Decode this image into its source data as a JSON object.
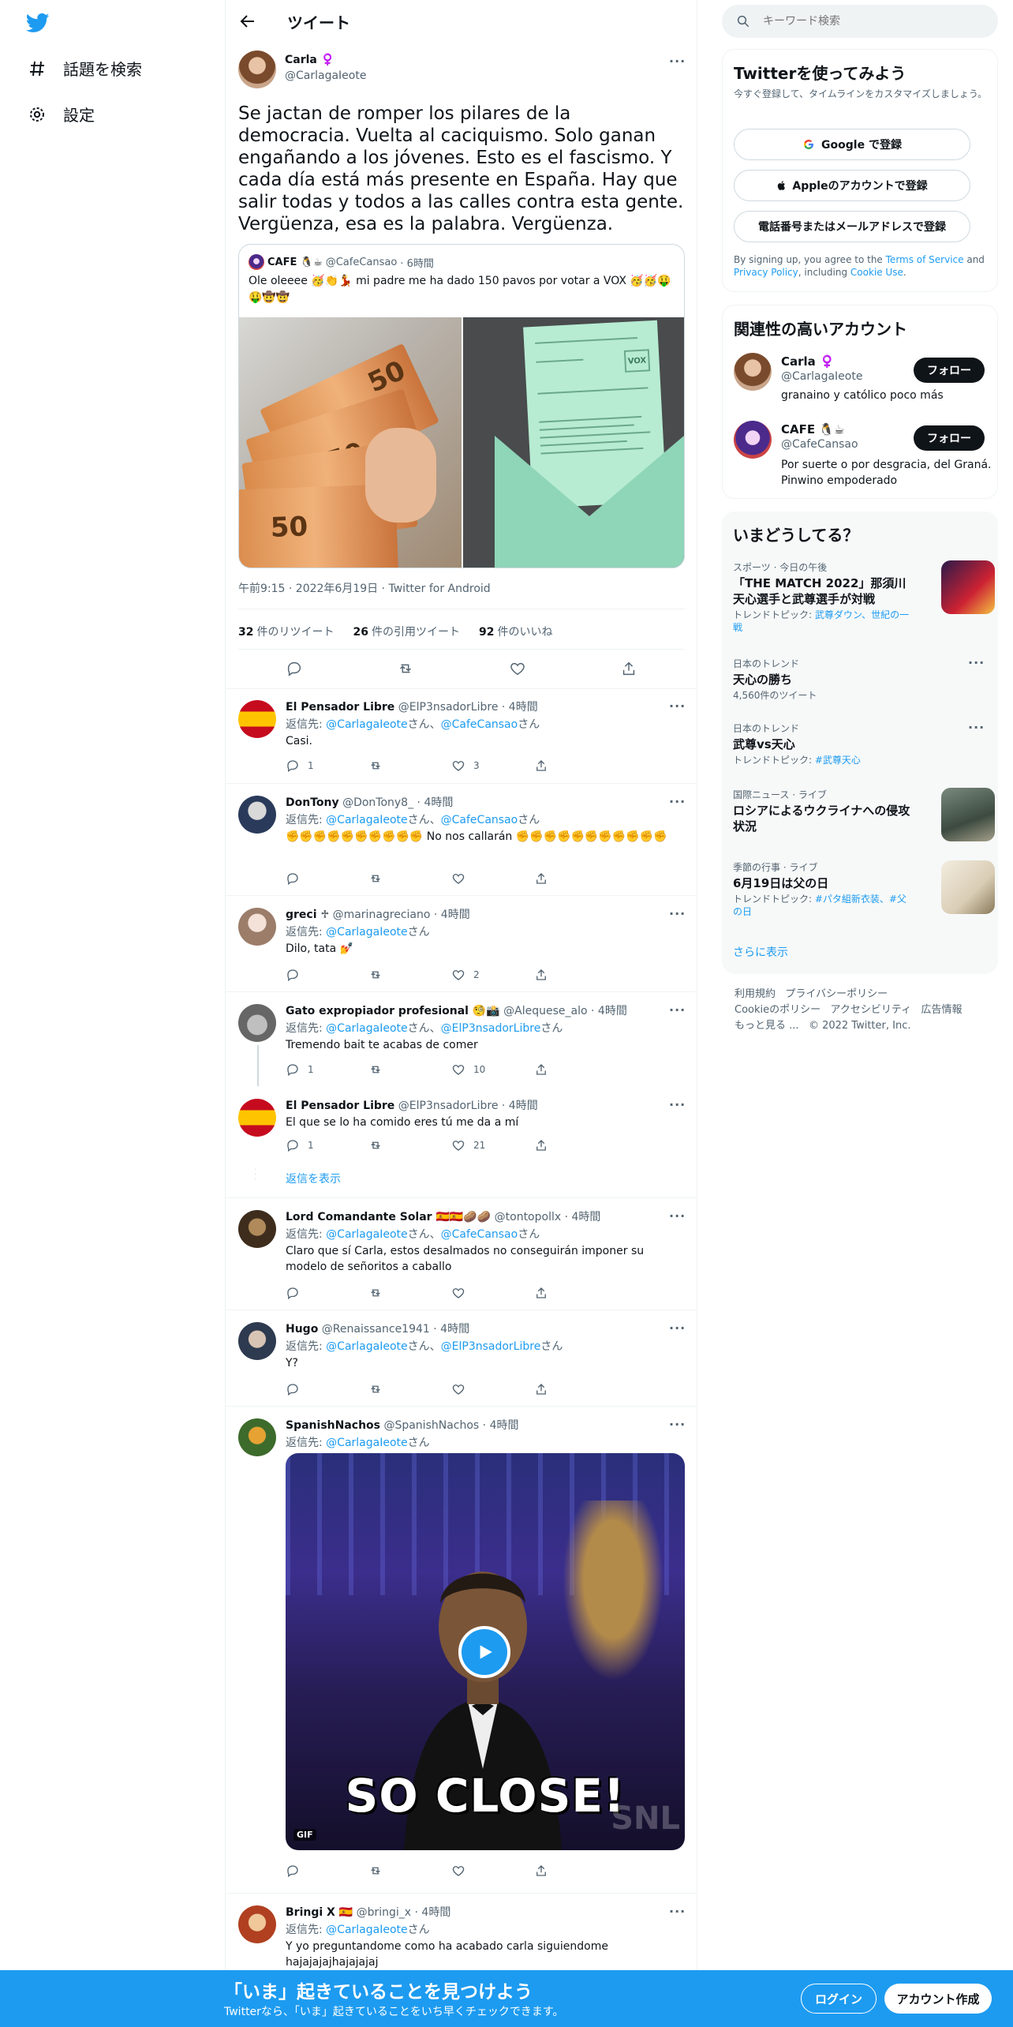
{
  "nav": {
    "explore": "話題を検索",
    "settings": "設定"
  },
  "header": {
    "title": "ツイート"
  },
  "tweet": {
    "name": "Carla ♀️",
    "handle": "@CarlagaIeote",
    "text": "Se jactan de romper los pilares de la democracia. Vuelta al caciquismo. Solo ganan engañando a los jóvenes. Esto es el fascismo. Y cada día está más presente en España. Hay que salir todas y todos a las calles contra esta gente. Vergüenza, esa es la palabra. Vergüenza.",
    "quote": {
      "name": "CAFE 🐧☕",
      "handle": "@CafeCansao",
      "time": "· 6時間",
      "text": "Ole oleeee 🥳👏💃 mi padre me ha dado 150 pavos por votar a VOX 🥳🥳🤑🤑🤠🤠"
    },
    "meta": "午前9:15 · 2022年6月19日 · Twitter for Android",
    "stats": {
      "retweets": "32",
      "retweets_label": "件のリツイート",
      "quotes": "26",
      "quotes_label": "件の引用ツイート",
      "likes": "92",
      "likes_label": "件のいいね"
    }
  },
  "replies": [
    {
      "name": "El Pensador Libre",
      "handle": "@ElP3nsadorLibre",
      "time": "· 4時間",
      "to_prefix": "返信先: ",
      "to1": "@CarlagaIeote",
      "to_mid": "さん、",
      "to2": "@CafeCansao",
      "to_suffix": "さん",
      "text": "Casi.",
      "replies": "1",
      "retweets": "",
      "likes": "3"
    },
    {
      "name": "DonTony",
      "handle": "@DonTony8_",
      "time": "· 4時間",
      "to_prefix": "返信先: ",
      "to1": "@CarlagaIeote",
      "to_mid": "さん、",
      "to2": "@CafeCansao",
      "to_suffix": "さん",
      "text": "✊✊✊✊✊✊✊✊✊✊ No nos callarán ✊✊✊✊✊✊✊✊✊✊✊",
      "replies": "",
      "retweets": "",
      "likes": ""
    },
    {
      "name": "greci ♱",
      "handle": "@marinagreciano",
      "time": "· 4時間",
      "to_prefix": "返信先: ",
      "to1": "@CarlagaIeote",
      "to_suffix": "さん",
      "text": "Dilo, tata 💅",
      "replies": "",
      "retweets": "",
      "likes": "2"
    },
    {
      "name": "Gato expropiador profesional 🧐📸",
      "handle": "@Alequese_alo",
      "time": "· 4時間",
      "to_prefix": "返信先: ",
      "to1": "@CarlagaIeote",
      "to_mid": "さん、",
      "to2": "@ElP3nsadorLibre",
      "to_suffix": "さん",
      "text": "Tremendo bait te acabas de comer",
      "replies": "1",
      "retweets": "",
      "likes": "10"
    },
    {
      "name": "El Pensador Libre",
      "handle": "@ElP3nsadorLibre",
      "time": "· 4時間",
      "text": "El que se lo ha comido eres tú me da a mí",
      "replies": "1",
      "retweets": "",
      "likes": "21"
    },
    {
      "name": "Lord Comandante Solar 🇪🇸🇪🇸🥔🥔",
      "handle": "@tontopollx",
      "time": "· 4時間",
      "to_prefix": "返信先: ",
      "to1": "@CarlagaIeote",
      "to_mid": "さん、",
      "to2": "@CafeCansao",
      "to_suffix": "さん",
      "text": "Claro que sí Carla, estos desalmados no conseguirán imponer su modelo de señoritos a caballo",
      "replies": "",
      "retweets": "",
      "likes": ""
    },
    {
      "name": "Hugo",
      "handle": "@Renaissance1941",
      "time": "· 4時間",
      "to_prefix": "返信先: ",
      "to1": "@CarlagaIeote",
      "to_mid": "さん、",
      "to2": "@ElP3nsadorLibre",
      "to_suffix": "さん",
      "text": "Y?",
      "replies": "",
      "retweets": "",
      "likes": ""
    },
    {
      "name": "SpanishNachos",
      "handle": "@SpanishNachos",
      "time": "· 4時間",
      "to_prefix": "返信先: ",
      "to1": "@CarlagaIeote",
      "to_suffix": "さん",
      "gif_caption": "SO CLOSE!",
      "gif_tag": "GIF",
      "gif_watermark": "SNL",
      "replies": "",
      "retweets": "",
      "likes": ""
    },
    {
      "name": "Bringi X 🇪🇸",
      "handle": "@bringi_x",
      "time": "· 4時間",
      "to_prefix": "返信先: ",
      "to1": "@CarlagaIeote",
      "to_suffix": "さん",
      "text": "Y yo preguntandome como ha acabado carla siguiendome hajajajajhajajajaj"
    }
  ],
  "show_replies": "返信を表示",
  "sidebar": {
    "search_placeholder": "キーワード検索",
    "signup": {
      "title": "Twitterを使ってみよう",
      "sub": "今すぐ登録して、タイムラインをカスタマイズしましょう。",
      "google": "Google で登録",
      "apple": "Appleのアカウントで登録",
      "phone": "電話番号またはメールアドレスで登録",
      "terms_pre": "By signing up, you agree to the ",
      "terms": "Terms of Service",
      "terms_mid": " and ",
      "privacy": "Privacy Policy",
      "terms_mid2": ", including ",
      "cookie": "Cookie Use",
      "terms_end": "."
    },
    "related": {
      "title": "関連性の高いアカウント",
      "accounts": [
        {
          "name": "Carla ♀️",
          "handle": "@CarlagaIeote",
          "bio": "granaino y católico poco más",
          "button": "フォロー"
        },
        {
          "name": "CAFE 🐧☕",
          "handle": "@CafeCansao",
          "bio": "Por suerte o por desgracia, del Graná. Pinwino empoderado",
          "button": "フォロー"
        }
      ]
    },
    "trends": {
      "title": "いまどうしてる？",
      "items": [
        {
          "cat": "スポーツ · 今日の午後",
          "title": "「THE MATCH 2022」那須川天心選手と武尊選手が対戦",
          "sub_pre": "トレンドトピック: ",
          "sub_link": "武尊ダウン、世紀の一戦",
          "sub_count": ""
        },
        {
          "cat": "日本のトレンド",
          "title": "天心の勝ち",
          "sub_pre": "",
          "sub_link": "",
          "sub_count": "4,560件のツイート"
        },
        {
          "cat": "日本のトレンド",
          "title": "武尊vs天心",
          "sub_pre": "トレンドトピック: ",
          "sub_link": "#武尊天心",
          "sub_count": ""
        },
        {
          "cat": "国際ニュース · ライブ",
          "title": "ロシアによるウクライナへの侵攻状況",
          "sub_pre": "",
          "sub_link": "",
          "sub_count": ""
        },
        {
          "cat": "季節の行事 · ライブ",
          "title": "6月19日は父の日",
          "sub_pre": "トレンドトピック: ",
          "sub_link": "#パタ組新衣装、#父の日",
          "sub_count": ""
        }
      ],
      "more": "さらに表示"
    },
    "footer": {
      "l1": "利用規約",
      "l2": "プライバシーポリシー",
      "l3": "Cookieのポリシー",
      "l4": "アクセシビリティ",
      "l5": "広告情報",
      "l6": "もっと見る ...",
      "copy": "© 2022 Twitter, Inc."
    }
  },
  "bottom": {
    "title": "「いま」起きていることを見つけよう",
    "sub": "Twitterなら、「いま」起きていることをいち早くチェックできます。",
    "login": "ログイン",
    "signup": "アカウント作成"
  },
  "colors": {
    "accent": "#1d9bf0",
    "like_red": "#f91880"
  }
}
